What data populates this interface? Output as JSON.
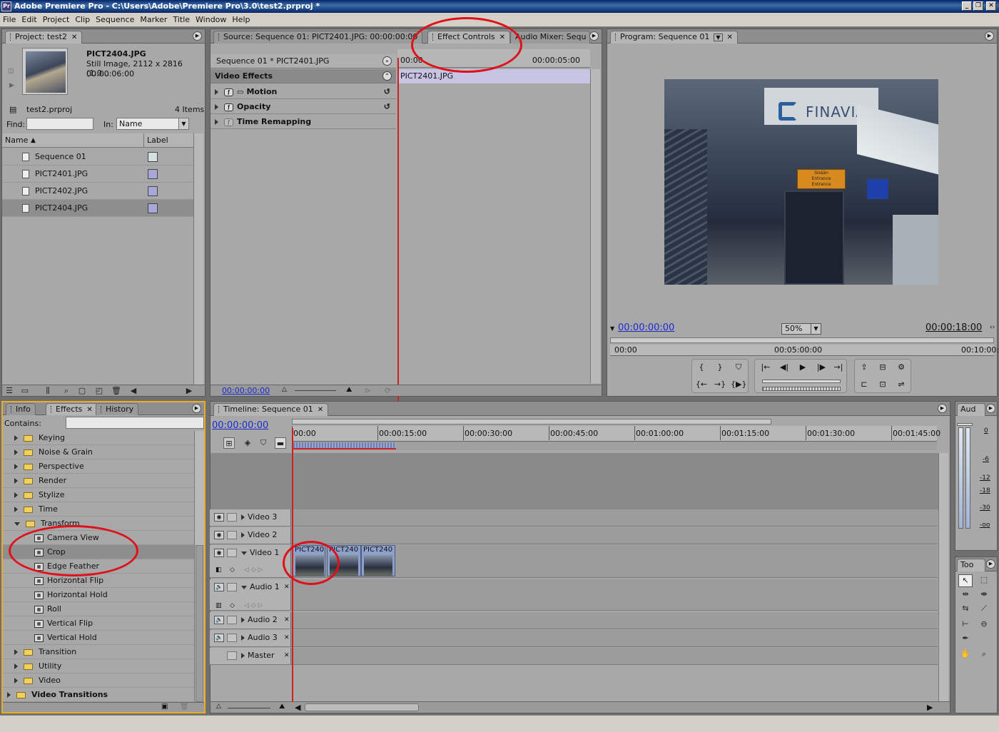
{
  "app": {
    "title": "Adobe Premiere Pro - C:\\Users\\Adobe\\Premiere Pro\\3.0\\test2.prproj *",
    "logo": "Pr"
  },
  "menu": [
    "File",
    "Edit",
    "Project",
    "Clip",
    "Sequence",
    "Marker",
    "Title",
    "Window",
    "Help"
  ],
  "project": {
    "tab": "Project: test2",
    "preview": {
      "name": "PICT2404.JPG",
      "info": "Still Image, 2112 x 2816 (1.0...",
      "duration": "00:00:06:00"
    },
    "file": "test2.prproj",
    "count": "4 Items",
    "find_label": "Find:",
    "in_label": "In:",
    "in_value": "Name",
    "col_name": "Name",
    "col_label": "Label",
    "items": [
      {
        "name": "Sequence 01",
        "color": "#d4e0e0"
      },
      {
        "name": "PICT2401.JPG",
        "color": "#a9a6d8"
      },
      {
        "name": "PICT2402.JPG",
        "color": "#a9a6d8"
      },
      {
        "name": "PICT2404.JPG",
        "color": "#a9a6d8"
      }
    ]
  },
  "effect_controls": {
    "tab_source": "Source: Sequence 01: PICT2401.JPG: 00:00:00:00",
    "tab_active": "Effect Controls",
    "tab_audio": "Audio Mixer: Sequ",
    "clip_header": "Sequence 01 * PICT2401.JPG",
    "time_start": "00:00",
    "time_end": "00:00:05:00",
    "clip_bar": "PICT2401.JPG",
    "section": "Video Effects",
    "effects": [
      "Motion",
      "Opacity",
      "Time Remapping"
    ],
    "timecode": "00:00:00:00"
  },
  "program": {
    "tab": "Program: Sequence 01",
    "image": {
      "sign": "FINAVIA",
      "sub1": "Sisään",
      "sub2": "Entrance",
      "sub3": "Entrance"
    },
    "timecode": "00:00:00:00",
    "zoom": "50%",
    "duration": "00:00:18:00",
    "ruler": [
      "00:00",
      "00:05:00:00",
      "00:10:00:"
    ]
  },
  "effects_panel": {
    "tabs": [
      "Info",
      "Effects",
      "History"
    ],
    "contains_label": "Contains:",
    "items": [
      {
        "label": "Keying",
        "kind": "folder",
        "open": false
      },
      {
        "label": "Noise & Grain",
        "kind": "folder",
        "open": false
      },
      {
        "label": "Perspective",
        "kind": "folder",
        "open": false
      },
      {
        "label": "Render",
        "kind": "folder",
        "open": false
      },
      {
        "label": "Stylize",
        "kind": "folder",
        "open": false
      },
      {
        "label": "Time",
        "kind": "folder",
        "open": false
      },
      {
        "label": "Transform",
        "kind": "folder",
        "open": true
      },
      {
        "label": "Camera View",
        "kind": "fx"
      },
      {
        "label": "Crop",
        "kind": "fx"
      },
      {
        "label": "Edge Feather",
        "kind": "fx"
      },
      {
        "label": "Horizontal Flip",
        "kind": "fx"
      },
      {
        "label": "Horizontal Hold",
        "kind": "fx"
      },
      {
        "label": "Roll",
        "kind": "fx"
      },
      {
        "label": "Vertical Flip",
        "kind": "fx"
      },
      {
        "label": "Vertical Hold",
        "kind": "fx"
      },
      {
        "label": "Transition",
        "kind": "folder",
        "open": false
      },
      {
        "label": "Utility",
        "kind": "folder",
        "open": false
      },
      {
        "label": "Video",
        "kind": "folder",
        "open": false
      },
      {
        "label": "Video Transitions",
        "kind": "root"
      }
    ]
  },
  "timeline": {
    "tab": "Timeline: Sequence 01",
    "timecode": "00:00:00:00",
    "ruler": [
      "00:00",
      "00:00:15:00",
      "00:00:30:00",
      "00:00:45:00",
      "00:01:00:00",
      "00:01:15:00",
      "00:01:30:00",
      "00:01:45:00"
    ],
    "tracks": [
      "Video 3",
      "Video 2",
      "Video 1",
      "Audio 1",
      "Audio 2",
      "Audio 3",
      "Master"
    ],
    "clips": [
      "PICT240",
      "PICT240",
      "PICT240"
    ]
  },
  "audio_meter": {
    "tab": "Aud",
    "scale": [
      "0",
      "-6",
      "-12",
      "-18",
      "-30",
      "-oo"
    ]
  },
  "tools": {
    "tab": "Too"
  },
  "colors": {
    "highlight": "#e0101a",
    "panel": "#a8a8a8",
    "timecode": "#1a2ad0"
  }
}
